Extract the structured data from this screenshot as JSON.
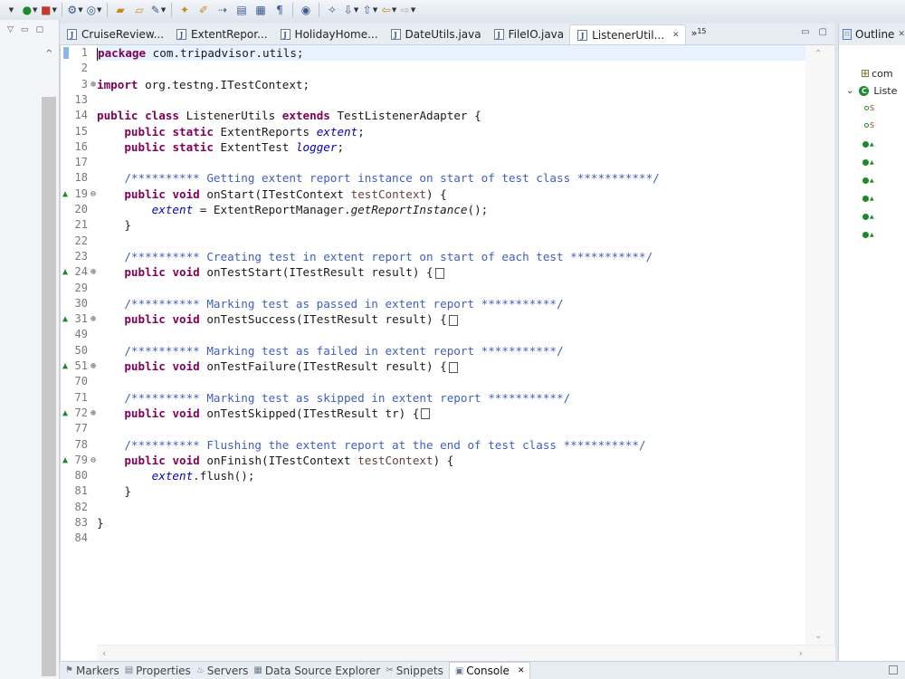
{
  "tabs": [
    {
      "label": "CruiseReview...",
      "active": false
    },
    {
      "label": "ExtentRepor...",
      "active": false
    },
    {
      "label": "HolidayHome...",
      "active": false
    },
    {
      "label": "DateUtils.java",
      "active": false
    },
    {
      "label": "FileIO.java",
      "active": false
    },
    {
      "label": "ListenerUtil...",
      "active": true
    }
  ],
  "tab_overflow": {
    "symbol": "»",
    "count": "15"
  },
  "tab_close_glyph": "✕",
  "outline": {
    "title": "Outline",
    "package_label": "com",
    "class_label": "Liste"
  },
  "code": {
    "package_stmt": "com.tripadvisor.utils;",
    "import_stmt": "org.testng.ITestContext;",
    "class_name": "ListenerUtils",
    "parent_class": "TestListenerAdapter",
    "field1_type": "ExtentReports",
    "field1_name": "extent",
    "field2_type": "ExtentTest",
    "field2_name": "logger",
    "comment_start": "/********** Getting extent report instance on start of test class ***********/",
    "comment_test_start": "/********** Creating test in extent report on start of each test ***********/",
    "comment_success": "/********** Marking test as passed in extent report ***********/",
    "comment_failure": "/********** Marking test as failed in extent report ***********/",
    "comment_skipped": "/********** Marking test as skipped in extent report ***********/",
    "comment_finish": "/********** Flushing the extent report at the end of test class ***********/",
    "onstart_sig": "onStart(ITestContext ",
    "onstart_param": "testContext",
    "onstart_body_recv": "ExtentReportManager.",
    "onstart_body_call": "getReportInstance",
    "ontest_start_sig": "onTestStart(ITestResult result) {",
    "ontest_success_sig": "onTestSuccess(ITestResult result) {",
    "ontest_failure_sig": "onTestFailure(ITestResult result) {",
    "ontest_skipped_sig": "onTestSkipped(ITestResult tr) {",
    "onfinish_sig": "onFinish(ITestContext ",
    "onfinish_param": "testContext",
    "flush_call": ".flush();"
  },
  "line_numbers": [
    "1",
    "2",
    "3",
    "13",
    "14",
    "15",
    "16",
    "17",
    "18",
    "19",
    "20",
    "21",
    "22",
    "23",
    "24",
    "29",
    "30",
    "31",
    "49",
    "50",
    "51",
    "70",
    "71",
    "72",
    "77",
    "78",
    "79",
    "80",
    "81",
    "82",
    "83",
    "84"
  ],
  "bottom_tabs": [
    {
      "label": "Markers",
      "active": false
    },
    {
      "label": "Properties",
      "active": false
    },
    {
      "label": "Servers",
      "active": false
    },
    {
      "label": "Data Source Explorer",
      "active": false
    },
    {
      "label": "Snippets",
      "active": false
    },
    {
      "label": "Console",
      "active": true
    }
  ]
}
